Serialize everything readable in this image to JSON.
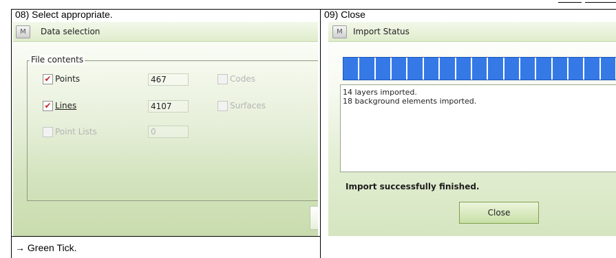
{
  "left_cell": {
    "step_title": "08) Select appropriate.",
    "dialog": {
      "title": "Data selection",
      "icon": "app-m-icon",
      "icon_glyph": "M",
      "group_label": "File contents",
      "options": [
        {
          "label": "Points",
          "checked": true,
          "enabled": true,
          "count": "467"
        },
        {
          "label": "Lines",
          "checked": true,
          "enabled": true,
          "count": "4107"
        },
        {
          "label": "Point Lists",
          "checked": false,
          "enabled": false,
          "count": "0"
        },
        {
          "label": "Codes",
          "checked": false,
          "enabled": false
        },
        {
          "label": "Surfaces",
          "checked": false,
          "enabled": false
        }
      ]
    },
    "note": "→ Green Tick."
  },
  "right_cell": {
    "step_title": "09) Close",
    "dialog": {
      "title": "Import Status",
      "icon": "app-m-icon",
      "icon_glyph": "M",
      "progress_fraction": 1.0,
      "log_lines": [
        "14 layers imported.",
        "18 background elements imported."
      ],
      "status_message": "Import successfully finished.",
      "close_label": "Close"
    }
  },
  "colors": {
    "accent_green": "#c8e0a6",
    "progress_blue": "#3579e7",
    "check_red": "#c0282a"
  }
}
